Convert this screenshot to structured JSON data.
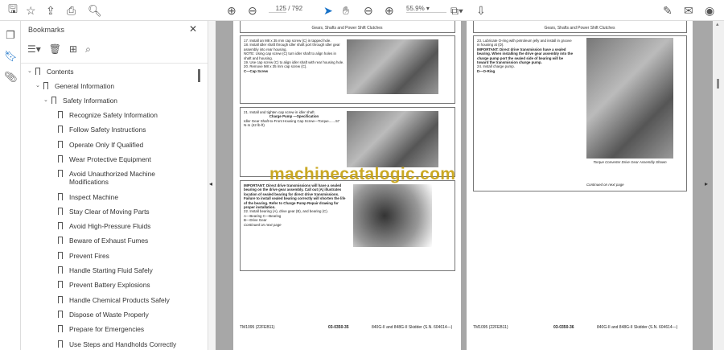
{
  "toolbar": {
    "page_current": "125",
    "page_total": "/ 792",
    "zoom": "55.9%"
  },
  "bookmarks": {
    "title": "Bookmarks",
    "items": [
      {
        "label": "Contents",
        "level": 0
      },
      {
        "label": "General Information",
        "level": 1
      },
      {
        "label": "Safety Information",
        "level": 2
      },
      {
        "label": "Recognize Safety Information",
        "level": 3
      },
      {
        "label": "Follow Safety Instructions",
        "level": 3
      },
      {
        "label": "Operate Only If Qualified",
        "level": 3
      },
      {
        "label": "Wear Protective Equipment",
        "level": 3
      },
      {
        "label": "Avoid Unauthorized Machine Modifications",
        "level": 3
      },
      {
        "label": "Inspect Machine",
        "level": 3
      },
      {
        "label": "Stay Clear of Moving Parts",
        "level": 3
      },
      {
        "label": "Avoid High-Pressure Fluids",
        "level": 3
      },
      {
        "label": "Beware of Exhaust Fumes",
        "level": 3
      },
      {
        "label": "Prevent Fires",
        "level": 3
      },
      {
        "label": "Handle Starting Fluid Safely",
        "level": 3
      },
      {
        "label": "Prevent Battery Explosions",
        "level": 3
      },
      {
        "label": "Handle Chemical Products Safely",
        "level": 3
      },
      {
        "label": "Dispose of Waste Properly",
        "level": 3
      },
      {
        "label": "Prepare for Emergencies",
        "level": 3
      },
      {
        "label": "Use Steps and Handholds Correctly",
        "level": 3
      }
    ]
  },
  "left_page": {
    "header": "Gears, Shafts and Power Shift Clutches",
    "box1": [
      "17. Install an M8 x 35 mm cap screw (C) in tapped hole.",
      "18. Install idler shaft through idler shaft port through idler gear assembly into rear housing.",
      "NOTE: Using cap screw (C) turn idler shaft to align holes in shaft and housing.",
      "19. Use cap screw (C) to align idler shaft with rear housing hole.",
      "20. Remove M8 x 35 mm cap screw (C).",
      "C—Cap Screw"
    ],
    "box2": [
      "21. Install and tighten cap screw in idler shaft.",
      "Charge Pump —Specification",
      "Idler Gear Shaft-to-Front Housing Cap Screw—Torque.......57 N·m (42 lb-ft)"
    ],
    "box3": [
      "IMPORTANT: Direct drive transmissions will have a sealed bearing on the drive gear assembly. Call out (A) illustrates location of sealed bearing for direct drive transmissions. Failure to install sealed bearing correctly will shorten the life of the bearing. Refer to Charge Pump Repair drawing for proper installation.",
      "22. Install bearing (A), drive gear (B), and bearing (C).",
      "A—Bearing   C—Bearing",
      "B—Drive Gear",
      "Continued on next page"
    ],
    "footer_left": "TM1095 (22FEB11)",
    "footer_mid": "03-0350-35",
    "footer_right": "840G-II and 848G-II Skidder (S.N. 604614—)"
  },
  "right_page": {
    "header": "Gears, Shafts and Power Shift Clutches",
    "box1": [
      "23. Lubricate O-ring with petroleum jelly and install in groove in housing at (D).",
      "IMPORTANT: Direct drive transmission have a sealed bearing. When installing the drive gear assembly into the charge pump port the sealed side of bearing will be toward the transmission charge pump.",
      "24. Install charge pump.",
      "D—O-Ring",
      "Torque Converter Drive Gear Assembly Shown",
      "Continued on next page"
    ],
    "footer_left": "TM1095 (22FEB11)",
    "footer_mid": "03-0350-36",
    "footer_right": "840G-II and 848G-II Skidder (S.N. 604614—)"
  },
  "watermark": "machinecatalogic.com"
}
